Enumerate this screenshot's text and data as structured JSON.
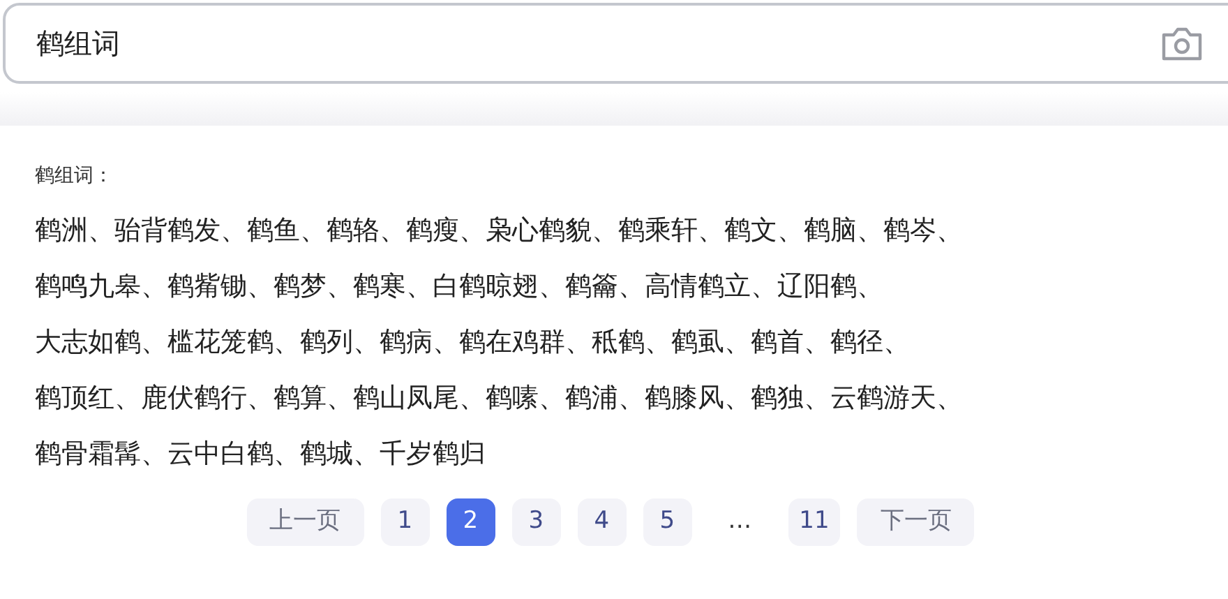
{
  "search": {
    "value": "鹤组词"
  },
  "result": {
    "label": "鹤组词：",
    "lines": [
      "鹤洲、骀背鹤发、鹤鱼、鹤辂、鹤瘦、枭心鹤貌、鹤乘轩、鹤文、鹤脑、鹤岑、",
      "鹤鸣九皋、鹤觜锄、鹤梦、鹤寒、白鹤晾翅、鹤籥、高情鹤立、辽阳鹤、",
      "大志如鹤、槛花笼鹤、鹤列、鹤病、鹤在鸡群、秪鹤、鹤虱、鹤首、鹤径、",
      "鹤顶红、鹿伏鹤行、鹤算、鹤山凤尾、鹤嗉、鹤浦、鹤膝风、鹤独、云鹤游天、",
      "鹤骨霜髯、云中白鹤、鹤城、千岁鹤归"
    ]
  },
  "pagination": [
    {
      "kind": "prev",
      "label": "上一页"
    },
    {
      "kind": "page",
      "label": "1",
      "selected": false
    },
    {
      "kind": "page",
      "label": "2",
      "selected": true
    },
    {
      "kind": "page",
      "label": "3",
      "selected": false
    },
    {
      "kind": "page",
      "label": "4",
      "selected": false
    },
    {
      "kind": "page",
      "label": "5",
      "selected": false
    },
    {
      "kind": "ellipsis",
      "label": "…"
    },
    {
      "kind": "page",
      "label": "11",
      "selected": false
    },
    {
      "kind": "next",
      "label": "下一页"
    }
  ]
}
